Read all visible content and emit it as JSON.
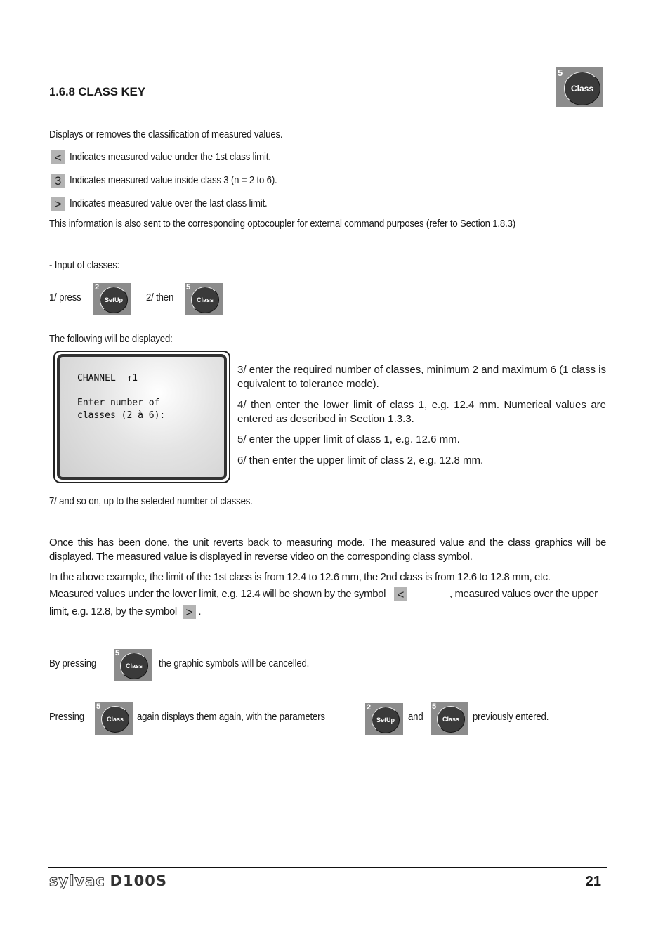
{
  "section": {
    "title": "1.6.8 CLASS KEY"
  },
  "keys": {
    "class": {
      "number": "5",
      "label": "Class"
    },
    "setup": {
      "number": "2",
      "label": "SetUp"
    }
  },
  "intro": "Displays or removes the classification of measured values.",
  "symbols": [
    {
      "glyph": "<",
      "text": "Indicates measured value under the 1st class limit."
    },
    {
      "glyph": "3",
      "text": "Indicates measured value inside class 3 (n = 2 to 6)."
    },
    {
      "glyph": ">",
      "text": "Indicates measured value over the last class limit."
    }
  ],
  "info": "This information is also sent to the corresponding optocoupler for external command purposes (refer to Section 1.8.3)",
  "input_heading": "- Input of classes:",
  "step1": "1/ press",
  "step2": "2/ then",
  "following": "The following will be displayed:",
  "lcd": {
    "line1": "CHANNEL  ↑1",
    "line2": "Enter number of",
    "line3": "classes (2 à 6):"
  },
  "steps": [
    "3/ enter the required number of classes, minimum 2 and maximum 6 (1 class is equivalent to tolerance mode).",
    "4/ then enter the lower limit of class 1, e.g. 12.4 mm. Numerical values are entered as described in Section 1.3.3.",
    "5/ enter the upper limit of class 1, e.g. 12.6 mm.",
    "6/ then enter the upper limit of class 2, e.g. 12.8 mm."
  ],
  "step7": "7/ and so on, up to the selected number of classes.",
  "after1": "Once this has been done, the unit reverts back to measuring mode. The measured value and the class graphics will be displayed. The measured value is displayed in reverse video on the corresponding class symbol.",
  "after2a": "In the above example, the limit of the 1st class is from 12.4 to 12.6 mm, the 2nd class is from 12.6 to 12.8 mm, etc.",
  "after2b": "Measured values under the lower limit, e.g. 12.4 will be shown by the symbol",
  "after2c": ", measured values over the upper",
  "after2d": "limit, e.g. 12.8, by the symbol",
  "after2e": ".",
  "sym_lt": "<",
  "sym_gt": ">",
  "cancel": {
    "before": "By pressing",
    "after": "the graphic symbols will be cancelled."
  },
  "again": {
    "before": "Pressing",
    "mid": "again displays them again, with the parameters",
    "and": "and",
    "after": "previously entered."
  },
  "footer": {
    "brand": "sylvac",
    "model": "D100S",
    "page": "21"
  }
}
